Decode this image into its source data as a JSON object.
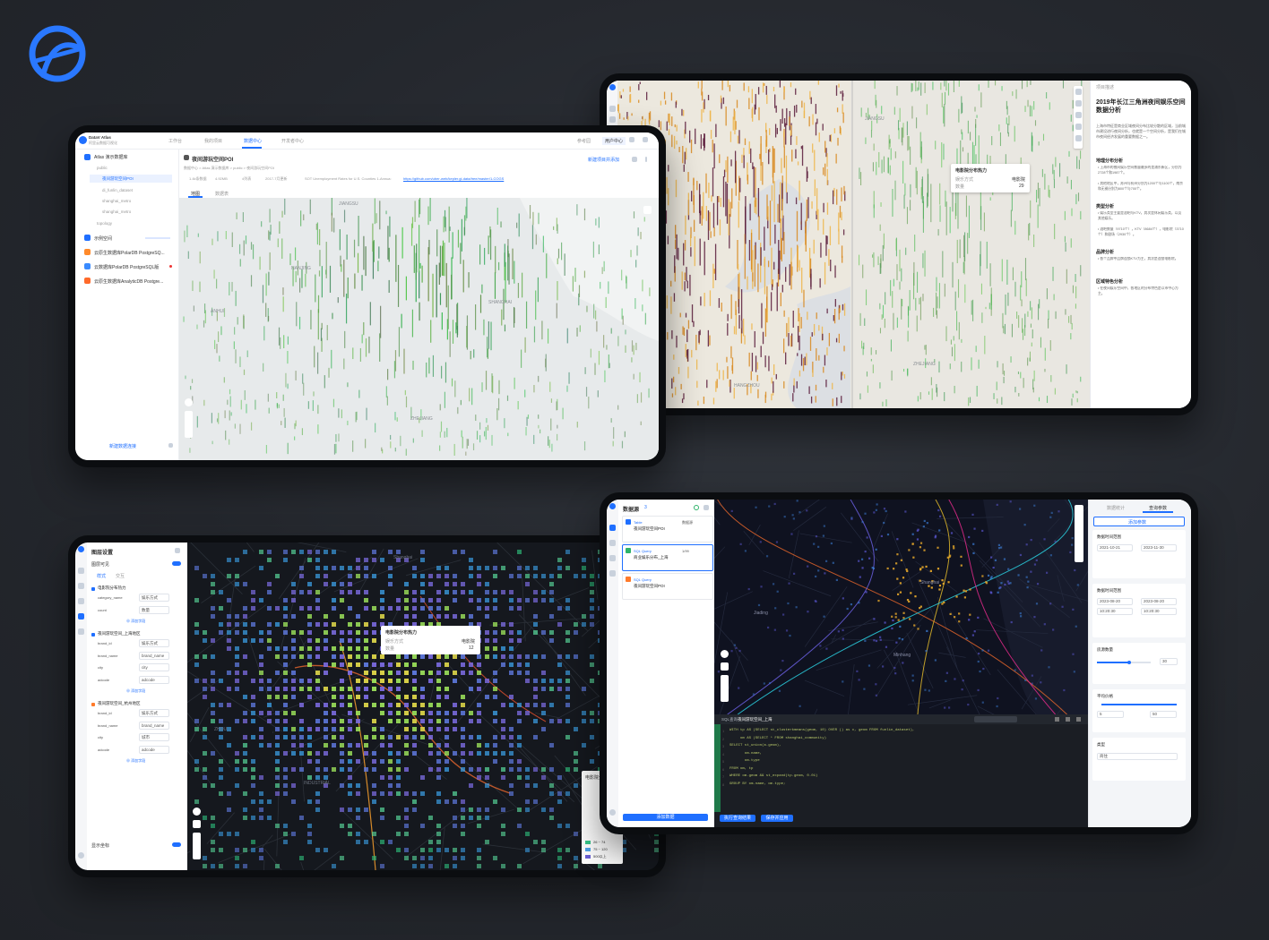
{
  "colors": {
    "accent": "#1f6fff",
    "background": "#26292f",
    "map_dark": "#14171d",
    "map_light": "#e9ebec",
    "green": "#2fb36a",
    "orange": "#d8892a"
  },
  "logo": {
    "icon": "atlas-logo-icon"
  },
  "screen1": {
    "brand": "DataV Atlas",
    "brand_sub": "阿里云数据可视化",
    "nav": [
      "工作台",
      "我的项目",
      "数据中心",
      "开发者中心"
    ],
    "nav_active": "数据中心",
    "header_right": [
      "参考园",
      "用户中心"
    ],
    "sidebar": {
      "root": "Atlas 演示数据库",
      "schema": "public",
      "tables": [
        "夜间游玩空间POI",
        "di_funlin_dataset",
        "shanghai_metro",
        "shanghai_metro"
      ],
      "topology": "topology",
      "items": [
        "示例空间",
        "云原生数据库PolarDB PostgreSQ...",
        "云数据库PolarDB PostgreSQL版",
        "云原生数据库AnalyticDB Postgre..."
      ],
      "add_button": "新建数据连接"
    },
    "title": "夜间游玩空间POI",
    "breadcrumb": "数据中心 > Atlas 演示数据库 > public > 夜间游玩空间POI",
    "action": "新建项目并添加",
    "meta": [
      "1.4k条数据",
      "4.92MB",
      "4列表",
      "2017-7月更新",
      "SOT Unemployment Rates for U.S. Counties 1-Annua:",
      "https://github.com/uber-web/kepler.gl-data/tree/master/1-COGS"
    ],
    "tabs": [
      "地图",
      "数据表"
    ],
    "map_labels": [
      "JIANGSU",
      "ANHUI",
      "ZHEJIANG",
      "NANJING",
      "SHANGHAI"
    ]
  },
  "screen2": {
    "panel_title": "项目描述",
    "heading": "2019年长江三角洲夜间娱乐空间数据分析",
    "intro": "上海市特征是商业区域夜间分布比较分散的区域，当前城市建设进行夜间分析，也就是一个空间分析，是我们在城市夜间经济发展的重要数据之一。",
    "sections": [
      {
        "title": "地理分布分析",
        "bullets": [
          "上海市的夜间娱乐空间数量最多的是浦东新区，分别为2728个和1987个。",
          "其他地区中，苏州与杭州分别为1200个与1100个，南京和无锡分别为800个与700个。"
        ]
      },
      {
        "title": "类型分析",
        "bullets": [
          "娱乐类型主要是酒吧与KTV，其次是休闲娱乐类，以及其他娱乐。",
          "酒吧数量（9710个），KTV（8684个），电影院（3710个）和剧场（2930个）。"
        ]
      },
      {
        "title": "品牌分析",
        "bullets": [
          "各个品牌中品牌连锁KTV为主，其次是连锁电影院。"
        ]
      },
      {
        "title": "区域特色分析",
        "bullets": [
          "在夜间娱乐空间中，各地区的分布特色是以市中心为主。"
        ]
      }
    ],
    "tooltip": {
      "title": "电影院分布热力",
      "rows": [
        [
          "娱乐方式",
          "电影院"
        ],
        [
          "数量",
          "29"
        ]
      ]
    },
    "map_labels": [
      "JIANGSU",
      "ZHEJIANG",
      "HANGZHOU"
    ]
  },
  "screen3": {
    "title": "图层设置",
    "show_label": "图层可见",
    "tabs": [
      "样式",
      "交互"
    ],
    "groups": [
      {
        "name": "电影院分布热力",
        "fields": [
          [
            "category_name",
            "娱乐方式"
          ],
          [
            "count",
            "数量"
          ]
        ]
      },
      {
        "name": "夜间游玩空间_上海地区",
        "fields": [
          [
            "brand_id",
            "娱乐方式"
          ],
          [
            "brand_name",
            "brand_name"
          ],
          [
            "city",
            "city"
          ],
          [
            "adcode",
            "adcode"
          ]
        ]
      },
      {
        "name": "夜间游玩空间_杭州地区",
        "fields": [
          [
            "brand_id",
            "娱乐方式"
          ],
          [
            "brand_name",
            "brand_name"
          ],
          [
            "city",
            "城市"
          ],
          [
            "adcode",
            "adcode"
          ]
        ]
      }
    ],
    "add_field": "添加字段",
    "footer_label": "显示坐标",
    "tooltip": {
      "title": "电影院分布热力",
      "rows": [
        [
          "娱乐方式",
          "电影院"
        ],
        [
          "数量",
          "12"
        ]
      ]
    },
    "legend_title": "电影院分布",
    "legend": [
      "26 ~ 74",
      "75 ~ 120",
      "500以上"
    ],
    "map_labels": [
      "Shanghai",
      "INDUSTRIAL",
      "ZHOU"
    ]
  },
  "screen4": {
    "title": "数据源",
    "badge": "3",
    "sources": [
      {
        "type": "Table",
        "name": "夜间游玩空间POI",
        "tag": "数据源"
      },
      {
        "type": "SQL Query",
        "name": "商业娱乐分布_上海",
        "tag": "1/99"
      },
      {
        "type": "SQL Query",
        "name": "夜间游玩空间POI",
        "tag": ""
      }
    ],
    "add_source": "添加数据",
    "sql_tab": "SQL查询",
    "sql_title": "夜间游玩空间_上海",
    "sql_lines": [
      "WITH tp AS (SELECT st_clusterkmeans(geom, 10) OVER () as c, geom FROM funlin_dataset),",
      "     om AS (SELECT * FROM shanghai_community)",
      "SELECT st_union(a.geom),",
      "       om.name,",
      "       om.type",
      "FROM om, tp",
      "WHERE om.geom && st_expand(tp.geom, 0.01)",
      "GROUP BY om.name, om.type;"
    ],
    "sql_buttons": [
      "执行查询结果",
      "保存并应用"
    ],
    "panel_tabs": [
      "数据统计",
      "查询参数"
    ],
    "add_param": "添加参数",
    "params": [
      {
        "name": "数据时间范围",
        "values": [
          "2021-10-21",
          "2023-11-30"
        ]
      },
      {
        "name": "数据时间范围",
        "values": [
          "2023-08-20",
          "2023-08-20"
        ],
        "times": [
          "10:20:30",
          "10:20:30"
        ]
      },
      {
        "name": "房源数量",
        "value": "30",
        "level": 0.6
      },
      {
        "name": "平均价格",
        "values": [
          "5",
          "50"
        ]
      },
      {
        "name": "类型",
        "value": "商住"
      }
    ],
    "map_labels": [
      "Shanghai",
      "Jiading",
      "Minhang"
    ]
  }
}
